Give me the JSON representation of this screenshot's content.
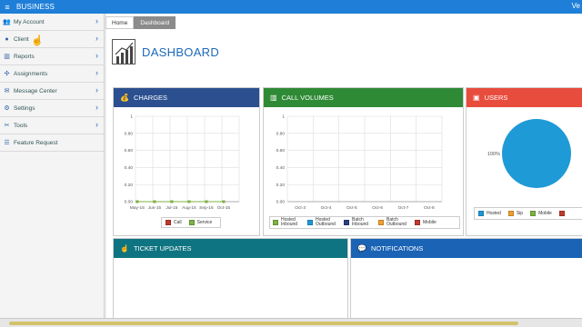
{
  "topbar": {
    "brand": "BUSINESS",
    "user": "Ve",
    "menu_icon": "hamburger-icon"
  },
  "sidebar": {
    "items": [
      {
        "label": "My Account",
        "icon": "users-icon"
      },
      {
        "label": "Client",
        "icon": "person-icon"
      },
      {
        "label": "Reports",
        "icon": "bar-chart-icon"
      },
      {
        "label": "Assignments",
        "icon": "assignments-icon"
      },
      {
        "label": "Message Center",
        "icon": "message-icon"
      },
      {
        "label": "Settings",
        "icon": "gear-icon"
      },
      {
        "label": "Tools",
        "icon": "wrench-icon"
      },
      {
        "label": "Feature Request",
        "icon": "list-icon"
      }
    ]
  },
  "breadcrumb": {
    "home": "Home",
    "current": "Dashboard"
  },
  "page": {
    "title": "DASHBOARD"
  },
  "panels": {
    "charges": {
      "title": "CHARGES",
      "color": "#2b4f8f"
    },
    "call_volumes": {
      "title": "CALL VOLUMES",
      "color": "#2f8a36"
    },
    "users": {
      "title": "USERS",
      "color": "#e84c3d"
    },
    "ticket_updates": {
      "title": "TICKET UPDATES",
      "color": "#0f7481"
    },
    "notifications": {
      "title": "NOTIFICATIONS",
      "color": "#1a63b5"
    }
  },
  "chart_data": [
    {
      "type": "line",
      "categories": [
        "May-15",
        "Jun-15",
        "Jul-15",
        "Aug-15",
        "Sep-15",
        "Oct-15"
      ],
      "series": [
        {
          "name": "Call",
          "color": "#c0392b",
          "values": [
            0,
            0,
            0,
            0,
            0,
            0
          ]
        },
        {
          "name": "Service",
          "color": "#7cb342",
          "values": [
            0,
            0,
            0,
            0,
            0,
            0
          ]
        }
      ],
      "yticks": [
        "1",
        "0.80",
        "0.60",
        "0.40",
        "0.20",
        "0.00"
      ],
      "ylim": [
        0,
        1
      ],
      "grid": true
    },
    {
      "type": "bar",
      "categories": [
        "Oct-3",
        "Oct-4",
        "Oct-5",
        "Oct-6",
        "Oct-7",
        "Oct-8"
      ],
      "series": [
        {
          "name": "Hosted Inbound",
          "color": "#7cb342",
          "values": [
            0,
            0,
            0,
            0,
            0,
            0
          ]
        },
        {
          "name": "Hosted Outbound",
          "color": "#1e9ad6",
          "values": [
            0,
            0,
            0,
            0,
            0,
            0
          ]
        },
        {
          "name": "Batch Inbound",
          "color": "#2b3f7f",
          "values": [
            0,
            0,
            0,
            0,
            0,
            0
          ]
        },
        {
          "name": "Batch Outbound",
          "color": "#f0a030",
          "values": [
            0,
            0,
            0,
            0,
            0,
            0
          ]
        },
        {
          "name": "Mobile",
          "color": "#c0392b",
          "values": [
            0,
            0,
            0,
            0,
            0,
            0
          ]
        }
      ],
      "yticks": [
        "1",
        "0.80",
        "0.60",
        "0.40",
        "0.20",
        "0.00"
      ],
      "ylim": [
        0,
        1
      ],
      "grid": true
    },
    {
      "type": "pie",
      "slices": [
        {
          "name": "Hosted",
          "color": "#1e9ad6",
          "value": 100,
          "label": "100%"
        },
        {
          "name": "Sip",
          "color": "#f0a030",
          "value": 0
        },
        {
          "name": "Mobile",
          "color": "#7cb342",
          "value": 0
        },
        {
          "name": "",
          "color": "#c0392b",
          "value": 0
        }
      ]
    }
  ]
}
